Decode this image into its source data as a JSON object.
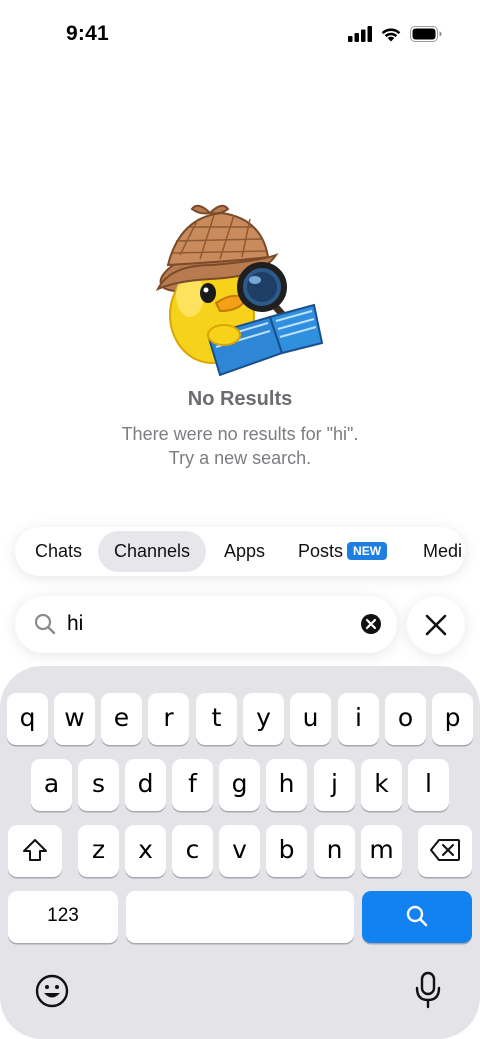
{
  "status_bar": {
    "time": "9:41"
  },
  "empty_state": {
    "title": "No Results",
    "line1": "There were no results for \"hi\".",
    "line2": "Try a new search."
  },
  "filters": [
    {
      "label": "Chats",
      "active": false
    },
    {
      "label": "Channels",
      "active": true
    },
    {
      "label": "Apps",
      "active": false
    },
    {
      "label": "Posts",
      "active": false,
      "badge": "NEW"
    },
    {
      "label": "Medi",
      "active": false
    }
  ],
  "search": {
    "value": "hi"
  },
  "keyboard": {
    "row1": [
      "q",
      "w",
      "e",
      "r",
      "t",
      "y",
      "u",
      "i",
      "o",
      "p"
    ],
    "row2": [
      "a",
      "s",
      "d",
      "f",
      "g",
      "h",
      "j",
      "k",
      "l"
    ],
    "row3": [
      "z",
      "x",
      "c",
      "v",
      "b",
      "n",
      "m"
    ],
    "numbers_key": "123"
  },
  "colors": {
    "accent": "#1182f0",
    "badge": "#1f7fe0",
    "keyboard_bg": "#e3e3e8"
  }
}
